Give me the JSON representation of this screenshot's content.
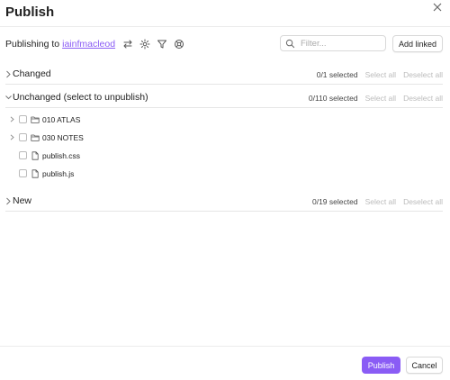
{
  "dialog": {
    "title": "Publish",
    "publishing_prefix": "Publishing to",
    "account": "iainfmacleod",
    "toolbar_icons": [
      "swap-icon",
      "settings-icon",
      "filter-icon",
      "support-icon"
    ],
    "filter_placeholder": "Filter...",
    "add_linked_label": "Add linked"
  },
  "sections": {
    "changed": {
      "name": "Changed",
      "count": "0/1 selected",
      "select_all": "Select all",
      "deselect_all": "Deselect all"
    },
    "unchanged": {
      "name": "Unchanged (select to unpublish)",
      "count": "0/110 selected",
      "select_all": "Select all",
      "deselect_all": "Deselect all",
      "items": [
        {
          "label": "010 ATLAS",
          "type": "folder",
          "expandable": true
        },
        {
          "label": "030 NOTES",
          "type": "folder",
          "expandable": true
        },
        {
          "label": "publish.css",
          "type": "file",
          "expandable": false
        },
        {
          "label": "publish.js",
          "type": "file",
          "expandable": false
        }
      ]
    },
    "new": {
      "name": "New",
      "count": "0/19 selected",
      "select_all": "Select all",
      "deselect_all": "Deselect all"
    }
  },
  "footer": {
    "publish_label": "Publish",
    "cancel_label": "Cancel"
  },
  "colors": {
    "accent": "#8a5cf5",
    "muted_action": "#bbbbbb",
    "divider": "#e6e6e6"
  }
}
